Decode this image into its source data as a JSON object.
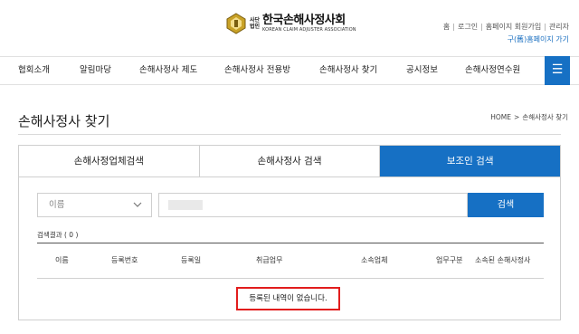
{
  "header": {
    "logo_sub_1": "사단",
    "logo_sub_2": "법인",
    "logo_ko": "한국손해사정사회",
    "logo_en": "KOREAN CLAIM ADJUSTER ASSOCIATION",
    "util_links": [
      "홈",
      "로그인",
      "홈페이지 회원가입",
      "관리자"
    ],
    "util_link2": "구(舊)홈페이지 가기"
  },
  "nav": {
    "items": [
      "협회소개",
      "알림마당",
      "손해사정사 제도",
      "손해사정사 전용방",
      "손해사정사 찾기",
      "공시정보",
      "손해사정연수원"
    ],
    "menu_icon": "☰"
  },
  "page": {
    "title": "손해사정사 찾기",
    "breadcrumb": [
      "HOME",
      ">",
      "손해사정사 찾기"
    ]
  },
  "tabs": [
    {
      "label": "손해사정업체검색",
      "active": false
    },
    {
      "label": "손해사정사 검색",
      "active": false
    },
    {
      "label": "보조인 검색",
      "active": true
    }
  ],
  "search": {
    "select_value": "이름",
    "input_value": "",
    "button_label": "검색"
  },
  "results": {
    "count_label": "검색결과 ( 0 )",
    "columns": [
      "이름",
      "등록번호",
      "등록일",
      "취급업무",
      "소속업체",
      "업무구분",
      "소속된 손해사정사"
    ],
    "empty_message": "등록된 내역이 없습니다."
  },
  "colors": {
    "accent": "#1670c4",
    "highlight": "#e21d1d"
  }
}
